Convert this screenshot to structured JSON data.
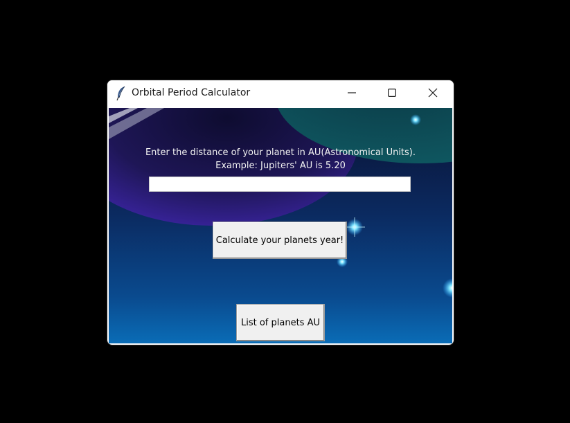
{
  "window": {
    "title": "Orbital Period Calculator",
    "app_icon": "feather-icon",
    "controls": {
      "minimize_icon": "minimize-icon",
      "maximize_icon": "maximize-icon",
      "close_icon": "close-icon"
    }
  },
  "main": {
    "instruction_line1": "Enter the distance of your planet in AU(Astronomical Units).",
    "instruction_line2": "Example: Jupiters' AU is 5.20",
    "au_input": {
      "value": "",
      "placeholder": ""
    },
    "calculate_button_label": "Calculate your planets year!",
    "list_button_label": "List of planets AU"
  },
  "colors": {
    "background_top": "#0a1030",
    "background_bottom": "#0a6cb6",
    "planet_teal": "#0d4a55",
    "planet_purple": "#2a1a6e",
    "text_light": "#f2f2f2",
    "button_face": "#f0f0f0"
  }
}
